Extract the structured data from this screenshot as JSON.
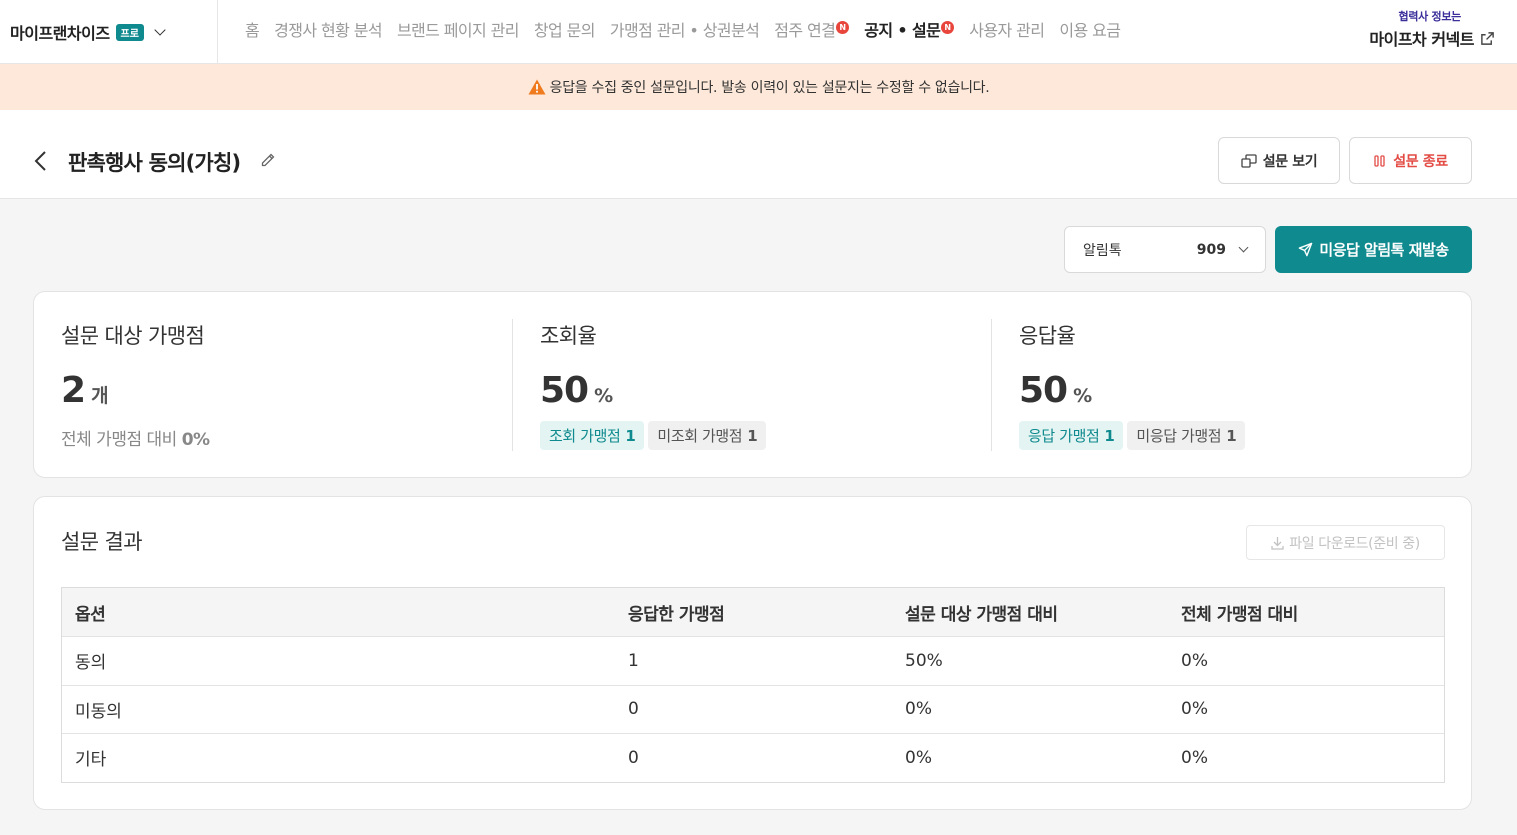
{
  "brand": {
    "name": "마이프랜차이즈",
    "plan": "프로"
  },
  "nav": {
    "items": [
      {
        "label": "홈"
      },
      {
        "label": "경쟁사 현황 분석"
      },
      {
        "label": "브랜드 페이지 관리"
      },
      {
        "label": "창업 문의"
      },
      {
        "label": "가맹점 관리 • 상권분석"
      },
      {
        "label": "점주 연결",
        "badge": "N"
      },
      {
        "label": "공지 • 설문",
        "badge": "N",
        "active": true
      },
      {
        "label": "사용자 관리"
      },
      {
        "label": "이용 요금"
      }
    ]
  },
  "partner": {
    "subtitle": "협력사 정보는",
    "title": "마이프차 커넥트"
  },
  "banner": {
    "message": "응답을 수집 중인 설문입니다. 발송 이력이 있는 설문지는 수정할 수 없습니다."
  },
  "survey": {
    "title": "판촉행사 동의(가칭)",
    "view_button": "설문 보기",
    "end_button": "설문 종료"
  },
  "controls": {
    "channel_label": "알림톡",
    "channel_count": "909",
    "resend_button": "미응답 알림톡 재발송"
  },
  "stats": {
    "target": {
      "title": "설문 대상 가맹점",
      "value": "2",
      "unit": "개",
      "sub_label": "전체 가맹점 대비",
      "sub_value": "0%"
    },
    "view_rate": {
      "title": "조회율",
      "value": "50",
      "unit": "%",
      "chip1_label": "조회 가맹점",
      "chip1_value": "1",
      "chip2_label": "미조회 가맹점",
      "chip2_value": "1"
    },
    "response_rate": {
      "title": "응답율",
      "value": "50",
      "unit": "%",
      "chip1_label": "응답 가맹점",
      "chip1_value": "1",
      "chip2_label": "미응답 가맹점",
      "chip2_value": "1"
    }
  },
  "results": {
    "title": "설문 결과",
    "download_button": "파일 다운로드(준비 중)",
    "columns": [
      "옵션",
      "응답한 가맹점",
      "설문 대상 가맹점 대비",
      "전체 가맹점 대비"
    ],
    "rows": [
      [
        "동의",
        "1",
        "50%",
        "0%"
      ],
      [
        "미동의",
        "0",
        "0%",
        "0%"
      ],
      [
        "기타",
        "0",
        "0%",
        "0%"
      ]
    ]
  },
  "colors": {
    "accent": "#0f8a8e",
    "danger": "#e34b45",
    "banner_bg": "#fde8d9",
    "warning": "#f07a1e",
    "badge": "#e8463c",
    "partner_text": "#3a2e9a"
  }
}
